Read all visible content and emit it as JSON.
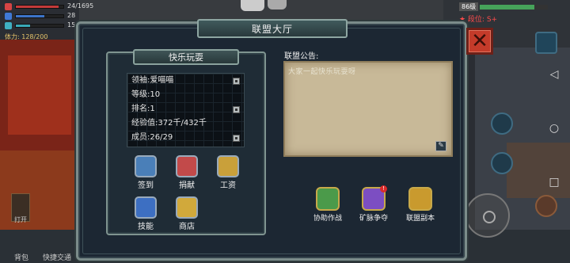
{
  "status": {
    "hp_text": "24/1695",
    "mp_text": "28",
    "sp_text": "15",
    "stamina": "体力: 128/200",
    "hp_fill": 0.9,
    "mp_fill": 0.6,
    "sp_fill": 0.3
  },
  "player": {
    "level": "86级",
    "rank": "★ 段位: S+",
    "xp_fill": 0.8
  },
  "dialog": {
    "title": "联盟大厅",
    "close": "✕"
  },
  "fun": {
    "title": "快乐玩耍",
    "leader": "领袖:爱喵喵",
    "level": "等级:10",
    "ranking": "排名:1",
    "exp": "经验值:372千/432千",
    "members": "成员:26/29"
  },
  "left_actions": [
    {
      "label": "签到",
      "icon": "signin-icon",
      "color": "#4a7fb8"
    },
    {
      "label": "捐献",
      "icon": "donate-icon",
      "color": "#c24a4a"
    },
    {
      "label": "工资",
      "icon": "salary-icon",
      "color": "#c9a03a"
    },
    {
      "label": "技能",
      "icon": "skill-icon",
      "color": "#3d6fc2"
    },
    {
      "label": "商店",
      "icon": "shop-icon",
      "color": "#d1a93b"
    }
  ],
  "notice": {
    "title": "联盟公告:",
    "text": "大家一起快乐玩耍呀",
    "edit": "✎"
  },
  "right_actions": [
    {
      "label": "协助作战",
      "icon": "assist-battle-icon",
      "color": "#4b9a4a",
      "pip": ""
    },
    {
      "label": "矿脉争夺",
      "icon": "mine-contest-icon",
      "color": "#7c4ec2",
      "pip": "!"
    },
    {
      "label": "联盟副本",
      "icon": "alliance-dungeon-icon",
      "color": "#c99a2e",
      "pip": ""
    }
  ],
  "hud": {
    "left_label": "打开",
    "bottom_labels": [
      "背包",
      "快捷交通",
      "选择"
    ]
  },
  "colors": {
    "panel_bg": "#1c2733",
    "frame": "#7b8c8a",
    "close_red": "#c43b2a",
    "notice_paper": "#c8b998"
  }
}
